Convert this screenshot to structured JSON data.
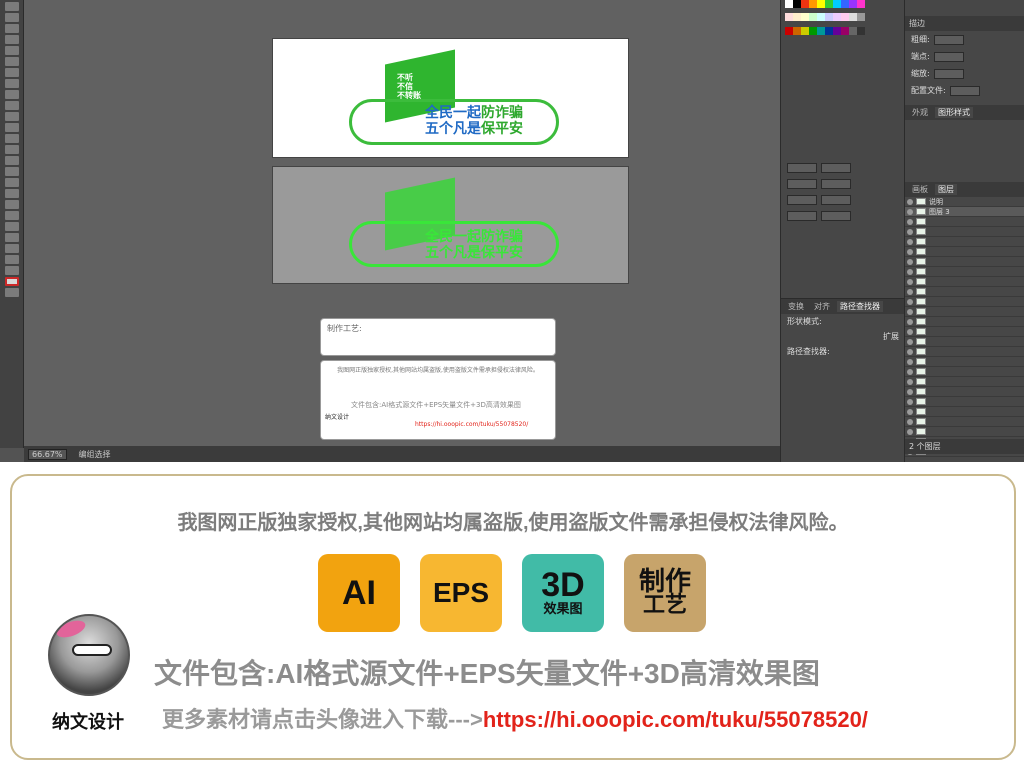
{
  "app": {
    "status_left": "66.67%",
    "status_mode": "编组选择",
    "prop_labels": [
      "描边",
      "粗细:",
      "端点:",
      "缩放:",
      "配置文件:"
    ],
    "appearance_tabs": [
      "外观",
      "图形样式"
    ],
    "layers_tabs": [
      "画板",
      "图层"
    ],
    "layer_title": "说明",
    "layer_sub": "图层 3",
    "layers_count": "2 个图层",
    "pathfinder_tabs": [
      "变换",
      "对齐",
      "路径查找器"
    ],
    "pathfinder_labels": [
      "形状模式:",
      "扩展",
      "路径查找器:"
    ]
  },
  "artboard_text": {
    "slogan_vertical": [
      "不听",
      "不信",
      "不转账"
    ],
    "slogan_main_1a": "全民一起",
    "slogan_main_1b": "防诈骗",
    "slogan_main_2a": "五个凡是",
    "slogan_main_2b": "保平安"
  },
  "card1": {
    "title": "制作工艺:"
  },
  "card2": {
    "notice_small": "我图网正版独家授权,其他网站均属盗版,使用盗版文件需承担侵权法律风险。",
    "contains_small": "文件包含:AI格式源文件+EPS矢量文件+3D高清效果图",
    "designer_small": "纳文设计",
    "url_small": "https://hi.ooopic.com/tuku/55078520/"
  },
  "promo": {
    "notice": "我图网正版独家授权,其他网站均属盗版,使用盗版文件需承担侵权法律风险。",
    "badges": [
      {
        "big": "AI",
        "color": "#f2a30f"
      },
      {
        "big": "EPS",
        "color": "#f7b731"
      },
      {
        "big": "3D",
        "small": "效果图",
        "color": "#41bba7"
      },
      {
        "mid": "制作",
        "small": "工艺",
        "color": "#c7a46b"
      }
    ],
    "contains": "文件包含:AI格式源文件+EPS矢量文件+3D高清效果图",
    "designer": "纳文设计",
    "more_prefix": "更多素材请点击头像进入下载--->",
    "url": "https://hi.ooopic.com/tuku/55078520/"
  }
}
